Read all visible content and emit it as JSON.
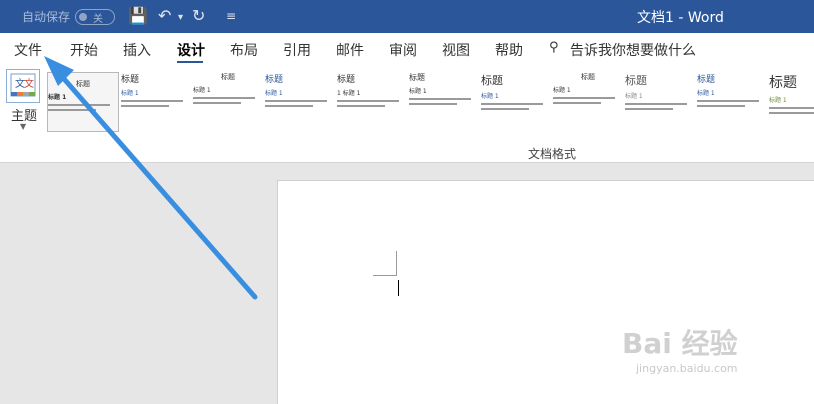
{
  "titlebar": {
    "autosave_label": "自动保存",
    "autosave_state": "关",
    "window_title": "文档1 - Word"
  },
  "tabs": [
    "文件",
    "开始",
    "插入",
    "设计",
    "布局",
    "引用",
    "邮件",
    "审阅",
    "视图",
    "帮助"
  ],
  "active_tab": "设计",
  "tell_me": "告诉我你想要做什么",
  "theme_label": "主题",
  "gallery": [
    {
      "title": "标题",
      "heading": "标题 1"
    },
    {
      "title": "标题",
      "heading": "标题 1"
    },
    {
      "title": "标题",
      "heading": "标题 1"
    },
    {
      "title": "标题",
      "heading": "标题 1"
    },
    {
      "title": "标题",
      "heading": "1 标题 1"
    },
    {
      "title": "标题",
      "heading": "标题 1"
    },
    {
      "title": "标题",
      "heading": "标题 1"
    },
    {
      "title": "标题",
      "heading": "标题 1"
    },
    {
      "title": "标题",
      "heading": "标题 1"
    },
    {
      "title": "标题",
      "heading": "标题 1"
    },
    {
      "title": "标题",
      "heading": "标题 1"
    }
  ],
  "group_label": "文档格式",
  "watermark": "Bai 经验",
  "watermark_url": "jingyan.baidu.com",
  "colors": {
    "titlebar": "#2b579a",
    "arrow": "#3a8ee0"
  }
}
